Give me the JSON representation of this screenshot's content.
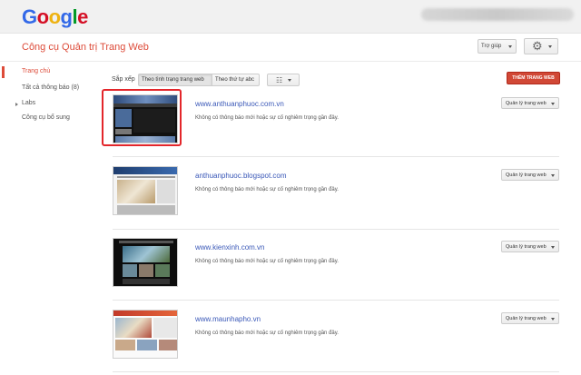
{
  "header": {
    "logo": [
      "G",
      "o",
      "o",
      "g",
      "l",
      "e"
    ],
    "logo_colors": [
      "#3369e8",
      "#d50f25",
      "#eeb211",
      "#3369e8",
      "#009925",
      "#d50f25"
    ],
    "app_title": "Công cụ Quản trị Trang Web",
    "help_label": "Trợ giúp"
  },
  "sidebar": {
    "items": [
      {
        "label": "Trang chủ"
      },
      {
        "label": "Tất cả thông báo (8)"
      },
      {
        "label": "Labs"
      },
      {
        "label": "Công cụ bổ sung"
      }
    ]
  },
  "toolbar": {
    "sort_label": "Sắp xếp",
    "sort_by_status": "Theo tình trạng trang web",
    "sort_alpha": "Theo thứ tự abc",
    "add_site": "THÊM TRANG WEB"
  },
  "sites": [
    {
      "url": "www.anthuanphuoc.com.vn",
      "message": "Không có thông báo mới hoặc sự cố nghiêm trọng gần đây.",
      "manage": "Quản lý trang web"
    },
    {
      "url": "anthuanphuoc.blogspot.com",
      "message": "Không có thông báo mới hoặc sự cố nghiêm trọng gần đây.",
      "manage": "Quản lý trang web"
    },
    {
      "url": "www.kienxinh.com.vn",
      "message": "Không có thông báo mới hoặc sự cố nghiêm trọng gần đây.",
      "manage": "Quản lý trang web"
    },
    {
      "url": "www.maunhapho.vn",
      "message": "Không có thông báo mới hoặc sự cố nghiêm trọng gần đây.",
      "manage": "Quản lý trang web"
    }
  ],
  "colors": {
    "accent_red": "#dd4b39",
    "link_blue": "#3b59b8",
    "add_button": "#d14836",
    "highlight": "#e3262b"
  },
  "icons": {
    "settings": "gear-icon",
    "view": "list-view-icon",
    "expand": "triangle-right-icon"
  }
}
